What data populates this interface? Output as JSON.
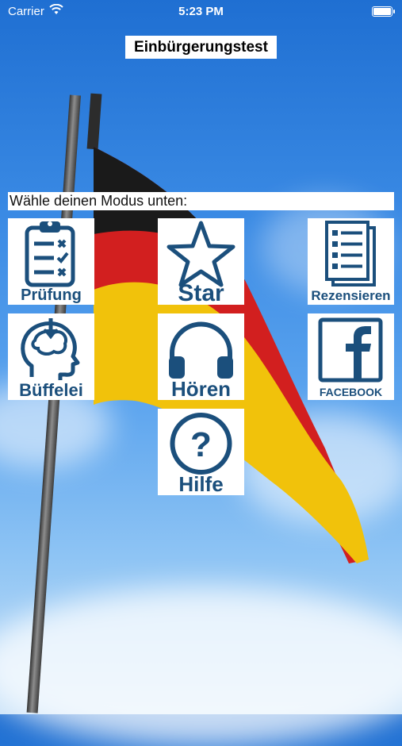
{
  "status_bar": {
    "carrier": "Carrier",
    "time": "5:23 PM"
  },
  "app": {
    "title": "Einbürgerungstest"
  },
  "mode_prompt": "Wähle deinen Modus unten:",
  "tiles": {
    "pruefung": {
      "label": "Prüfung",
      "icon": "clipboard-checklist-icon"
    },
    "star": {
      "label": "Star",
      "icon": "star-icon"
    },
    "rezensieren": {
      "label": "Rezensieren",
      "icon": "document-list-icon"
    },
    "bueffelei": {
      "label": "Büffelei",
      "icon": "head-brain-icon"
    },
    "hoeren": {
      "label": "Hören",
      "icon": "headphones-icon"
    },
    "facebook": {
      "label": "FACEBOOK",
      "icon": "facebook-icon"
    },
    "hilfe": {
      "label": "Hilfe",
      "icon": "question-icon"
    }
  },
  "colors": {
    "icon_blue": "#1b4f7c",
    "sky": "#3a8ae4",
    "flag_black": "#1a1a1a",
    "flag_red": "#d21f1f",
    "flag_gold": "#f1c20b"
  }
}
